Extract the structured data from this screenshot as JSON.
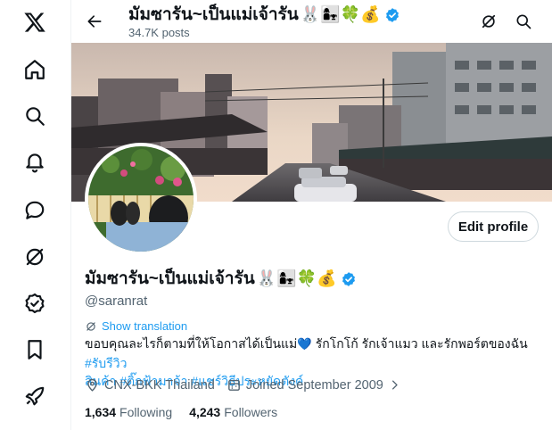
{
  "app": "X",
  "colors": {
    "accent": "#1d9bf0",
    "text": "#0f1419",
    "muted": "#536471",
    "border": "#cfd9de"
  },
  "nav": {
    "items": [
      {
        "name": "x-logo-icon",
        "label": "X"
      },
      {
        "name": "home-icon",
        "label": "Home"
      },
      {
        "name": "search-icon",
        "label": "Explore"
      },
      {
        "name": "bell-icon",
        "label": "Notifications"
      },
      {
        "name": "chat-bubble-icon",
        "label": "Messages"
      },
      {
        "name": "grok-icon",
        "label": "Grok"
      },
      {
        "name": "verified-badge-icon",
        "label": "Premium"
      },
      {
        "name": "bookmark-icon",
        "label": "Bookmarks"
      },
      {
        "name": "rocket-icon",
        "label": "More"
      }
    ]
  },
  "header": {
    "title": "มัมซารัน~เป็นแม่เจ้ารัน",
    "title_emoji": "🐰👩‍👧🍀💰",
    "posts_count": "34.7K posts"
  },
  "profile": {
    "display_name": "มัมซารัน~เป็นแม่เจ้ารัน",
    "name_emoji": "🐰👩‍👧🍀💰",
    "handle": "@saranrat",
    "edit_button": "Edit profile",
    "show_translation": "Show translation",
    "bio_line1_text": "ขอบคุณละไรก็ตามที่ให้โอกาสได้เป็นแม่",
    "bio_heart": "💙",
    "bio_line1_rest": " รักโกโก้ รักเจ้าแมว และรักพอร์ตของฉัน ",
    "bio_hashtag1": "#รับรีวิว",
    "bio_hashtag2": "สินค้า",
    "bio_hashtag3": "#ติ๊กฟ้ามาจ้า",
    "bio_hashtag4": "#แชร์วิธีประหยัดตังค์",
    "location": "CNX-BKK Thailand",
    "joined": "Joined September 2009",
    "following_count": "1,634",
    "following_label": "Following",
    "followers_count": "4,243",
    "followers_label": "Followers"
  }
}
